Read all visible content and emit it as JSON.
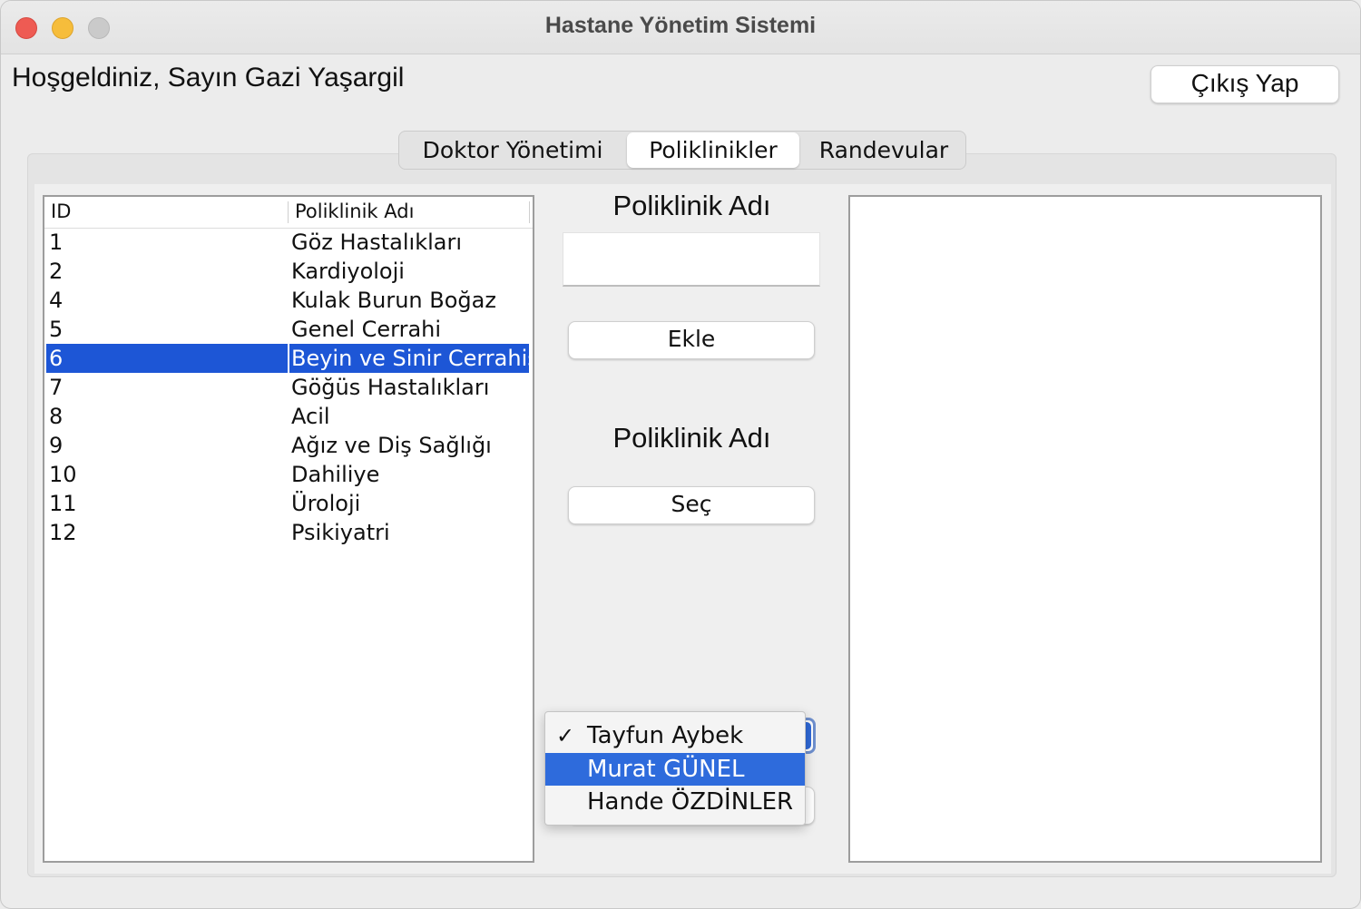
{
  "window": {
    "title": "Hastane Yönetim Sistemi"
  },
  "header": {
    "welcome": "Hoşgeldiniz, Sayın Gazi Yaşargil",
    "logout_label": "Çıkış Yap"
  },
  "tabs": [
    {
      "label": "Doktor Yönetimi",
      "active": false
    },
    {
      "label": "Poliklinikler",
      "active": true
    },
    {
      "label": "Randevular",
      "active": false
    }
  ],
  "table": {
    "columns": [
      "ID",
      "Poliklinik Adı"
    ],
    "rows": [
      {
        "id": "1",
        "name": "Göz Hastalıkları"
      },
      {
        "id": "2",
        "name": "Kardiyoloji"
      },
      {
        "id": "4",
        "name": "Kulak Burun Boğaz"
      },
      {
        "id": "5",
        "name": "Genel Cerrahi"
      },
      {
        "id": "6",
        "name": "Beyin ve Sinir Cerrahisi",
        "selected": true
      },
      {
        "id": "7",
        "name": "Göğüs Hastalıkları"
      },
      {
        "id": "8",
        "name": "Acil"
      },
      {
        "id": "9",
        "name": "Ağız ve Diş Sağlığı"
      },
      {
        "id": "10",
        "name": "Dahiliye"
      },
      {
        "id": "11",
        "name": "Üroloji"
      },
      {
        "id": "12",
        "name": "Psikiyatri"
      }
    ]
  },
  "form": {
    "name_label": "Poliklinik Adı",
    "name_value": "",
    "add_label": "Ekle",
    "name_label_2": "Poliklinik Adı",
    "select_label": "Seç"
  },
  "doctor_dropdown": {
    "selected": "Tayfun Aybek",
    "options": [
      {
        "label": "Tayfun Aybek",
        "checked": true,
        "highlighted": false
      },
      {
        "label": "Murat GÜNEL",
        "checked": false,
        "highlighted": true
      },
      {
        "label": "Hande ÖZDİNLER",
        "checked": false,
        "highlighted": false
      }
    ],
    "check_mark": "✓"
  },
  "colors": {
    "selection": "#1d56d6",
    "menu_highlight": "#2e6bdc"
  }
}
